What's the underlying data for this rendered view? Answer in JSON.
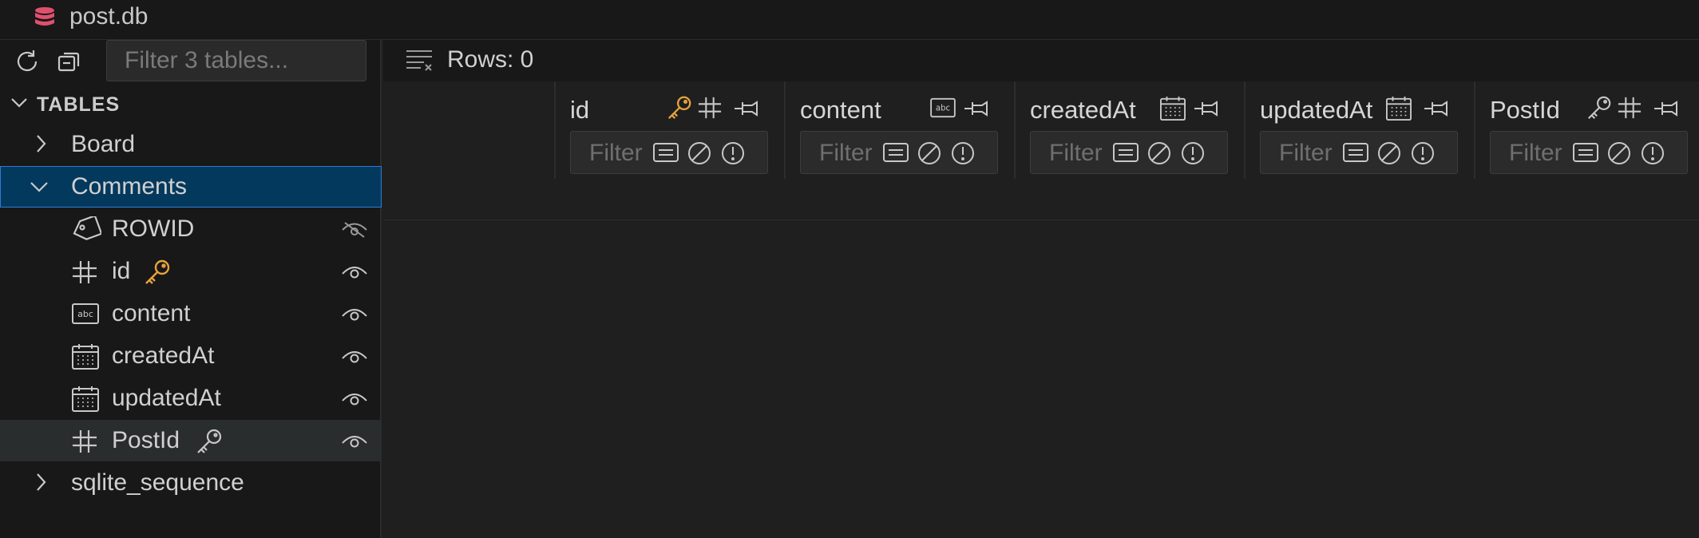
{
  "title_bar": {
    "file_name": "post.db",
    "db_icon": "database-icon",
    "icon_color": "#e0506e"
  },
  "sidebar": {
    "toolbar": {
      "refresh_icon": "refresh-icon",
      "collapse_icon": "collapse-all-icon",
      "filter_placeholder": "Filter 3 tables..."
    },
    "section_label": "TABLES",
    "tables": [
      {
        "name": "Board",
        "expanded": false
      },
      {
        "name": "Comments",
        "expanded": true,
        "selected": true,
        "columns": [
          {
            "name": "ROWID",
            "type_icon": "tag-icon",
            "visibility_icon": "eye-closed-icon",
            "key": false
          },
          {
            "name": "id",
            "type_icon": "number-icon",
            "visibility_icon": "eye-icon",
            "key": true,
            "key_color": "#e8a33d"
          },
          {
            "name": "content",
            "type_icon": "text-abc-icon",
            "visibility_icon": "eye-icon",
            "key": false
          },
          {
            "name": "createdAt",
            "type_icon": "calendar-icon",
            "visibility_icon": "eye-icon",
            "key": false
          },
          {
            "name": "updatedAt",
            "type_icon": "calendar-icon",
            "visibility_icon": "eye-icon",
            "key": false
          },
          {
            "name": "PostId",
            "type_icon": "number-icon",
            "visibility_icon": "eye-icon",
            "key": true,
            "key_color": "#c8c8c8"
          }
        ]
      },
      {
        "name": "sqlite_sequence",
        "expanded": false
      }
    ]
  },
  "main": {
    "rows_label": "Rows: 0",
    "columns": [
      {
        "name": "id",
        "filter_placeholder": "Filter"
      },
      {
        "name": "content",
        "filter_placeholder": "Filter"
      },
      {
        "name": "createdAt",
        "filter_placeholder": "Filter"
      },
      {
        "name": "updatedAt",
        "filter_placeholder": "Filter"
      },
      {
        "name": "PostId",
        "filter_placeholder": "Filter"
      }
    ]
  }
}
